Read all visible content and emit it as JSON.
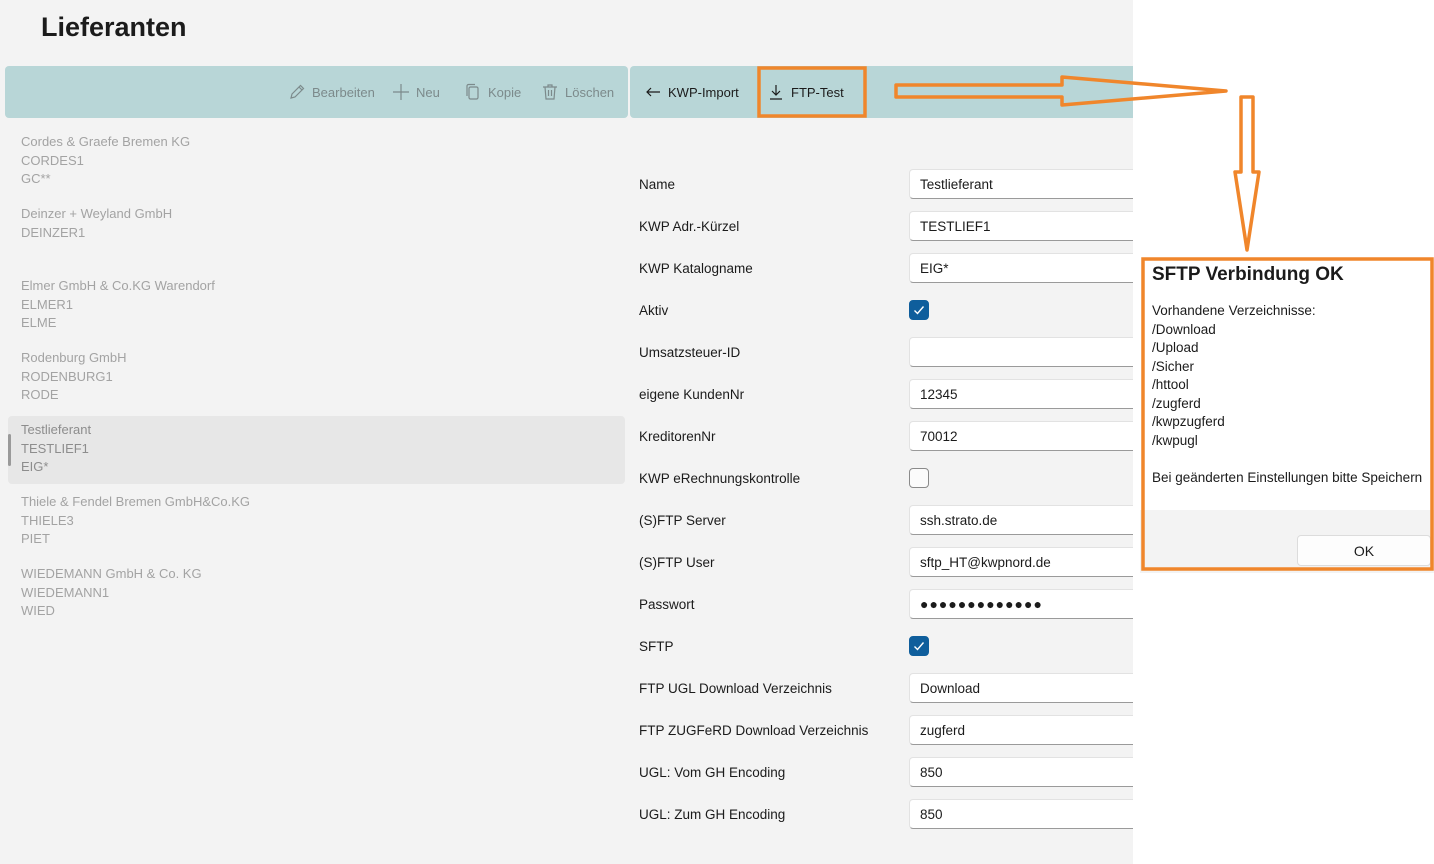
{
  "page": {
    "title": "Lieferanten"
  },
  "toolbar": {
    "edit_label": "Bearbeiten",
    "new_label": "Neu",
    "copy_label": "Kopie",
    "delete_label": "Löschen",
    "kwp_import_label": "KWP-Import",
    "ftp_test_label": "FTP-Test"
  },
  "suppliers": [
    {
      "name": "Cordes & Graefe Bremen KG",
      "code": "CORDES1",
      "catalog": "GC**"
    },
    {
      "name": "Deinzer + Weyland GmbH",
      "code": "DEINZER1",
      "catalog": ""
    },
    {
      "name": "Elmer GmbH & Co.KG Warendorf",
      "code": "ELMER1",
      "catalog": "ELME"
    },
    {
      "name": "Rodenburg GmbH",
      "code": "RODENBURG1",
      "catalog": "RODE"
    },
    {
      "name": "Testlieferant",
      "code": "TESTLIEF1",
      "catalog": "EIG*"
    },
    {
      "name": "Thiele & Fendel Bremen GmbH&Co.KG",
      "code": "THIELE3",
      "catalog": "PIET"
    },
    {
      "name": "WIEDEMANN GmbH & Co. KG",
      "code": "WIEDEMANN1",
      "catalog": "WIED"
    }
  ],
  "form": {
    "name": {
      "label": "Name",
      "value": "Testlieferant"
    },
    "kwp_adr": {
      "label": "KWP Adr.-Kürzel",
      "value": "TESTLIEF1"
    },
    "kwp_katalog": {
      "label": "KWP Katalogname",
      "value": "EIG*"
    },
    "aktiv": {
      "label": "Aktiv",
      "checked": true
    },
    "ust_id": {
      "label": "Umsatzsteuer-ID",
      "value": ""
    },
    "kunden_nr": {
      "label": "eigene KundenNr",
      "value": "12345"
    },
    "kreditoren_nr": {
      "label": "KreditorenNr",
      "value": "70012"
    },
    "erechnung": {
      "label": "KWP eRechnungskontrolle",
      "checked": false
    },
    "sftp_server": {
      "label": "(S)FTP Server",
      "value": "ssh.strato.de"
    },
    "sftp_user": {
      "label": "(S)FTP User",
      "value": "sftp_HT@kwpnord.de"
    },
    "passwort": {
      "label": "Passwort",
      "value": "●●●●●●●●●●●●●"
    },
    "sftp": {
      "label": "SFTP",
      "checked": true
    },
    "ugl_dir": {
      "label": "FTP UGL Download Verzeichnis",
      "value": "Download"
    },
    "zugferd_dir": {
      "label": "FTP ZUGFeRD Download Verzeichnis",
      "value": "zugferd"
    },
    "ugl_from": {
      "label": "UGL: Vom GH Encoding",
      "value": "850"
    },
    "ugl_to": {
      "label": "UGL: Zum GH Encoding",
      "value": "850"
    }
  },
  "dialog": {
    "title": "SFTP Verbindung OK",
    "lines": [
      "Vorhandene Verzeichnisse:",
      "/Download",
      "/Upload",
      "/Sicher",
      "/httool",
      "/zugferd",
      "/kwpzugferd",
      "/kwpugl",
      "",
      "Bei geänderten Einstellungen bitte Speichern"
    ],
    "ok_label": "OK"
  },
  "colors": {
    "annotation": "#f0862b",
    "toolbar": "#b8d6d7",
    "checkbox": "#0f5e9c"
  }
}
